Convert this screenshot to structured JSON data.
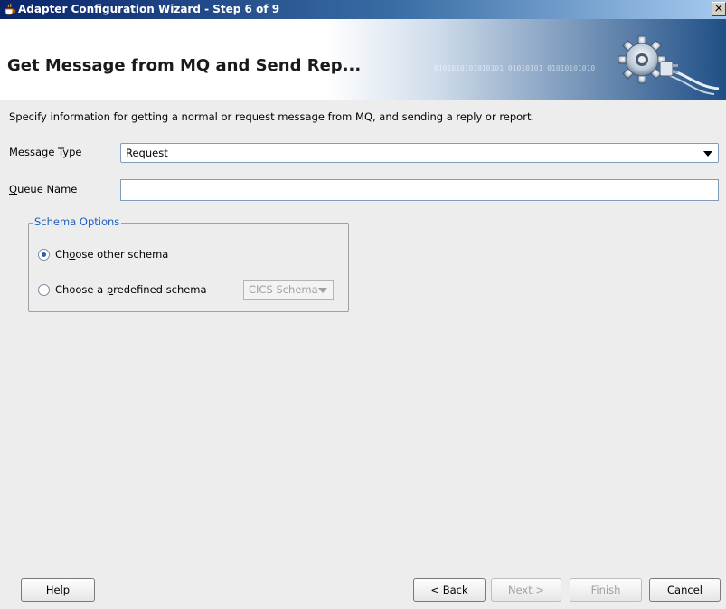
{
  "window": {
    "title": "Adapter Configuration Wizard - Step 6 of 9",
    "close_glyph": "×"
  },
  "header": {
    "title": "Get Message from MQ and Send Rep...",
    "binary_text": "0101010101010101 01010101 01010101010",
    "art_icon": "gear-plug-icon"
  },
  "body": {
    "instructions": "Specify information for getting a normal or request message from MQ, and sending a reply or report.",
    "message_type": {
      "label": "Message Type",
      "value": "Request"
    },
    "queue_name": {
      "label_prefix": "Q",
      "label_rest": "ueue Name",
      "value": ""
    },
    "schema_options": {
      "legend": "Schema Options",
      "choose_other": {
        "pre": "Ch",
        "mnemonic": "o",
        "post": "ose other schema",
        "selected": true
      },
      "choose_predefined": {
        "pre": "Choose a ",
        "mnemonic": "p",
        "post": "redefined schema",
        "selected": false
      },
      "predefined_select_value": "CICS Schema"
    }
  },
  "buttons": {
    "help": {
      "mnemonic": "H",
      "rest": "elp"
    },
    "back": {
      "pre": "< ",
      "mnemonic": "B",
      "rest": "ack"
    },
    "next": {
      "mnemonic": "N",
      "rest": "ext >"
    },
    "finish": {
      "mnemonic": "F",
      "rest": "inish"
    },
    "cancel": {
      "label": "Cancel"
    }
  },
  "colors": {
    "title_bar": "#0a246a",
    "legend_text": "#1f5fbf",
    "radio_dot": "#2a5db0"
  }
}
